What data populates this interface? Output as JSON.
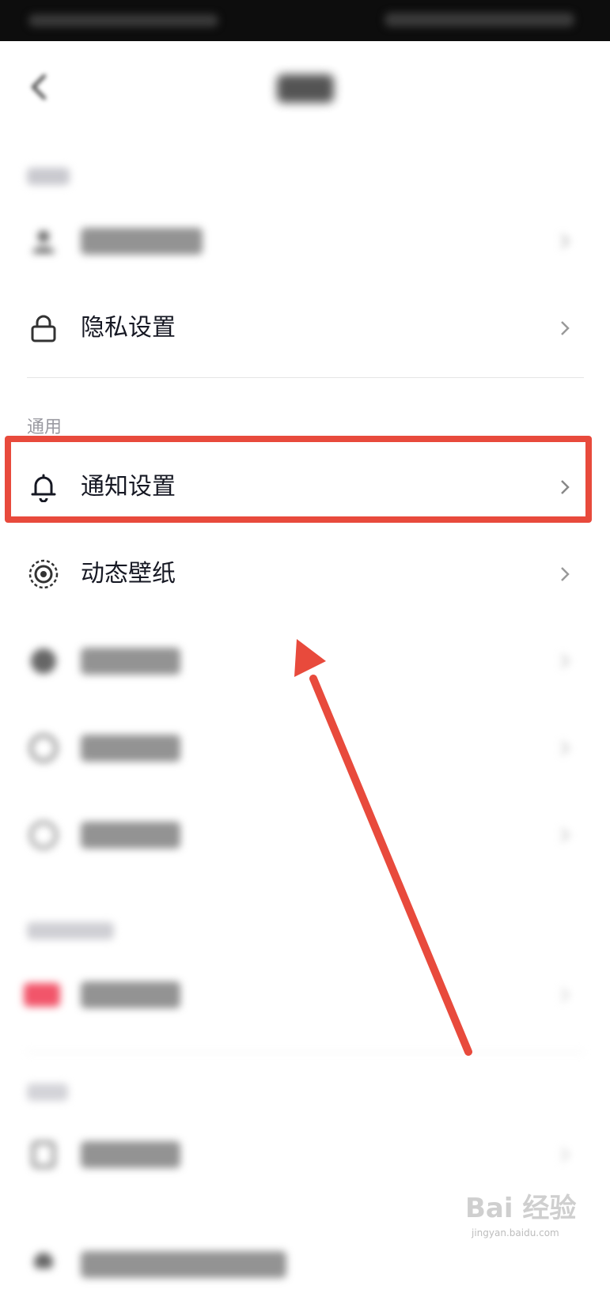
{
  "general_section_label": "通用",
  "rows": {
    "privacy": {
      "label": "隐私设置"
    },
    "notification": {
      "label": "通知设置"
    },
    "wallpaper": {
      "label": "动态壁纸"
    }
  },
  "watermark": {
    "text": "Bai 经验",
    "url": "jingyan.baidu.com"
  },
  "colors": {
    "highlight": "#e84a3c",
    "accent_red": "#e84a3c"
  }
}
